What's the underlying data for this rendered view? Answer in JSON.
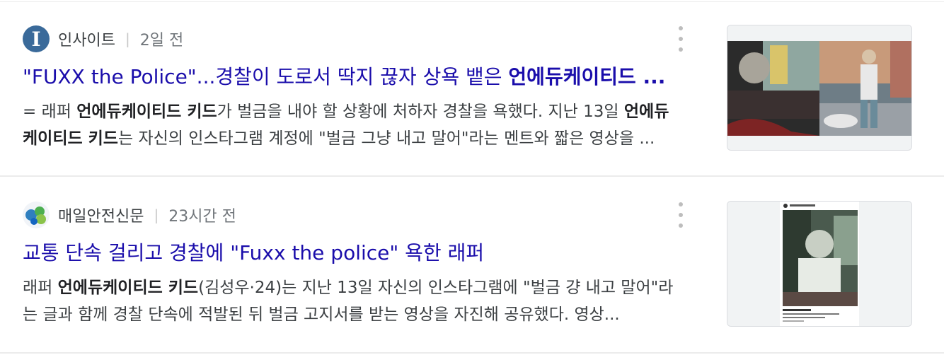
{
  "results": [
    {
      "source": "인사이트",
      "logo_letter": "I",
      "time": "2일 전",
      "title_plain": "\"FUXX the Police\"...경찰이 도로서 딱지 끊자 상욕 뱉은 ",
      "title_bold": "언에듀케이티드 ...",
      "snippet_parts": [
        {
          "t": "= 래퍼 ",
          "b": false
        },
        {
          "t": "언에듀케이티드 키드",
          "b": true
        },
        {
          "t": "가 벌금을 내야 할 상황에 처하자 경찰을 욕했다. 지난 13일 ",
          "b": false
        },
        {
          "t": "언에듀케이티드 키드",
          "b": true
        },
        {
          "t": "는 자신의 인스타그램 계정에 \"벌금 그냥 내고 말어\"라는 멘트와 짧은 영상을 ...",
          "b": false
        }
      ]
    },
    {
      "source": "매일안전신문",
      "time": "23시간 전",
      "title_plain": "교통 단속 걸리고 경찰에 \"Fuxx the police\" 욕한 래퍼",
      "snippet_parts": [
        {
          "t": "래퍼 ",
          "b": false
        },
        {
          "t": "언에듀케이티드 키드",
          "b": true
        },
        {
          "t": "(김성우·24)는 지난 13일 자신의 인스타그램에 \"벌금 걍 내고 말어\"라는 글과 함께 경찰 단속에 적발된 뒤 벌금 고지서를 받는 영상을 자진해 공유했다. 영상...",
          "b": false
        }
      ]
    }
  ]
}
